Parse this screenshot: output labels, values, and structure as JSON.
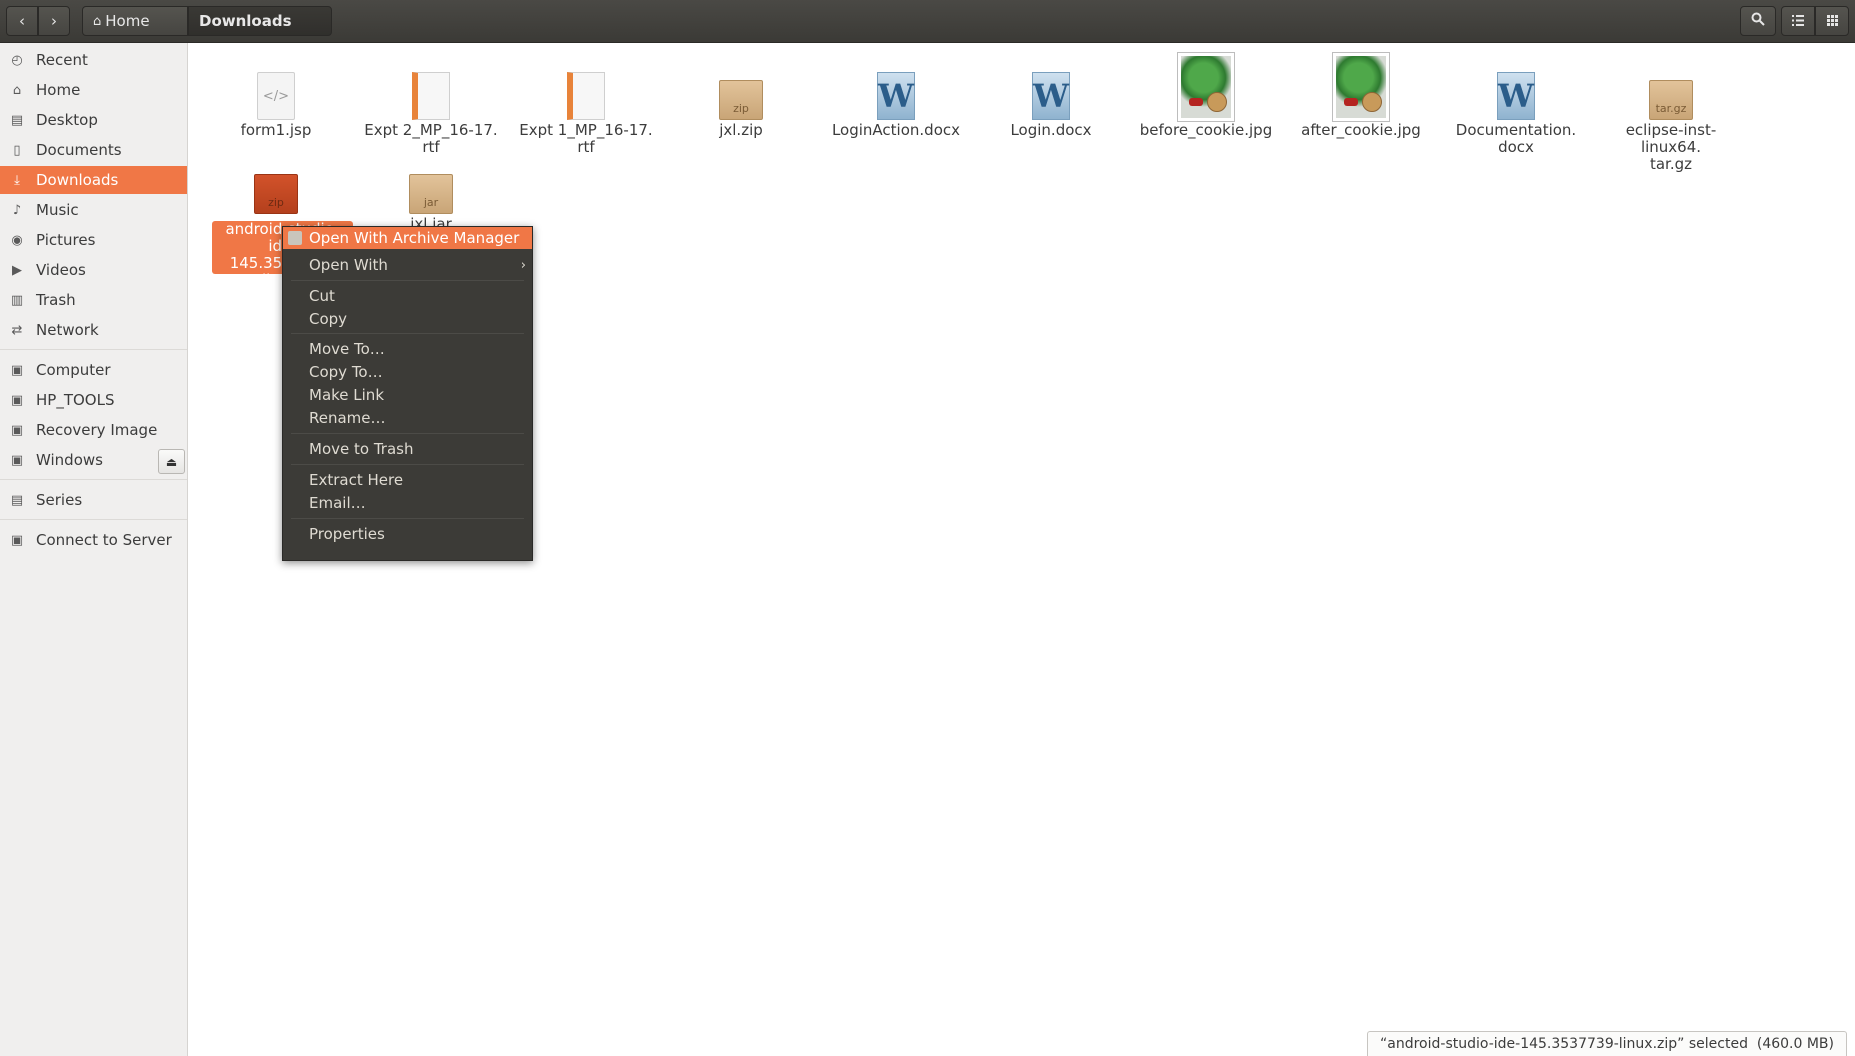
{
  "header": {
    "back_icon": "chevron-left-icon",
    "forward_icon": "chevron-right-icon",
    "breadcrumb": [
      "Home",
      "Downloads"
    ],
    "search_icon": "search-icon",
    "list_view_icon": "list-view-icon",
    "grid_view_icon": "grid-view-icon"
  },
  "sidebar": {
    "items": [
      {
        "label": "Recent",
        "icon": "clock-icon"
      },
      {
        "label": "Home",
        "icon": "home-icon"
      },
      {
        "label": "Desktop",
        "icon": "folder-icon"
      },
      {
        "label": "Documents",
        "icon": "document-icon"
      },
      {
        "label": "Downloads",
        "icon": "download-icon",
        "active": true
      },
      {
        "label": "Music",
        "icon": "music-icon"
      },
      {
        "label": "Pictures",
        "icon": "camera-icon"
      },
      {
        "label": "Videos",
        "icon": "video-icon"
      },
      {
        "label": "Trash",
        "icon": "trash-icon"
      },
      {
        "label": "Network",
        "icon": "network-icon"
      }
    ],
    "devices": [
      {
        "label": "Computer",
        "icon": "drive-icon"
      },
      {
        "label": "HP_TOOLS",
        "icon": "drive-icon"
      },
      {
        "label": "Recovery Image",
        "icon": "drive-icon"
      },
      {
        "label": "Windows",
        "icon": "drive-icon"
      }
    ],
    "bookmarks": [
      {
        "label": "Series",
        "icon": "folder-icon"
      }
    ],
    "connect": {
      "label": "Connect to Server",
      "icon": "server-icon"
    }
  },
  "files": [
    {
      "name_lines": [
        "form1.jsp"
      ],
      "type": "jsp"
    },
    {
      "name_lines": [
        "Expt 2_MP_16-17.",
        "rtf"
      ],
      "type": "rtf"
    },
    {
      "name_lines": [
        "Expt 1_MP_16-17.",
        "rtf"
      ],
      "type": "rtf"
    },
    {
      "name_lines": [
        "jxl.zip"
      ],
      "type": "zip",
      "badge": "zip"
    },
    {
      "name_lines": [
        "LoginAction.docx"
      ],
      "type": "docx"
    },
    {
      "name_lines": [
        "Login.docx"
      ],
      "type": "docx"
    },
    {
      "name_lines": [
        "before_cookie.jpg"
      ],
      "type": "jpg"
    },
    {
      "name_lines": [
        "after_cookie.jpg"
      ],
      "type": "jpg"
    },
    {
      "name_lines": [
        "Documentation.",
        "docx"
      ],
      "type": "docx"
    },
    {
      "name_lines": [
        "eclipse-inst-linux64.",
        "tar.gz"
      ],
      "type": "targz",
      "badge": "tar.gz"
    },
    {
      "name_lines": [
        "android-studio-ide-",
        "145.3537739-linux.",
        "zip"
      ],
      "type": "zip",
      "badge": "zip",
      "selected": true
    },
    {
      "name_lines": [
        "jxl.jar"
      ],
      "type": "jar",
      "badge": "jar"
    }
  ],
  "context_menu": {
    "items": [
      {
        "label": "Open With Archive Manager",
        "highlighted": true,
        "icon": "archive-manager-icon"
      },
      {
        "label": "Open With",
        "submenu": true
      },
      {
        "label": "Cut"
      },
      {
        "label": "Copy"
      },
      {
        "label": "Move To…"
      },
      {
        "label": "Copy To…"
      },
      {
        "label": "Make Link"
      },
      {
        "label": "Rename…"
      },
      {
        "label": "Move to Trash"
      },
      {
        "label": "Extract Here"
      },
      {
        "label": "Email…"
      },
      {
        "label": "Properties"
      }
    ]
  },
  "status": {
    "text": "“android-studio-ide-145.3537739-linux.zip” selected  (460.0 MB)"
  },
  "colors": {
    "accent": "#f07746",
    "headerbar": "#3c3b37",
    "menu_bg": "#3c3b37"
  }
}
